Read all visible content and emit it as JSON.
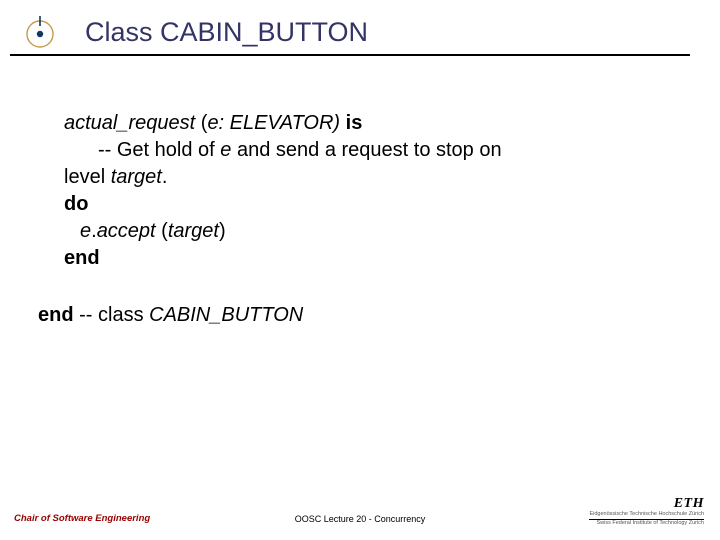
{
  "title": "Class CABIN_BUTTON",
  "code": {
    "l1_a": "actual_request ",
    "l1_b": "(",
    "l1_c": "e: ELEVATOR) ",
    "l1_d": "is",
    "l2_a": "-- Get hold of ",
    "l2_b": "e",
    "l2_c": " and send a request to stop on",
    "l3_a": "level ",
    "l3_b": "target",
    "l3_c": ".",
    "l4": "do",
    "l5_a": "e",
    "l5_b": ".",
    "l5_c": "accept ",
    "l5_d": "(",
    "l5_e": "target",
    "l5_f": ")",
    "l6": "end",
    "cls_a": "end",
    "cls_b": " -- class ",
    "cls_c": "CABIN_BUTTON"
  },
  "footer": {
    "left": "Chair of Software Engineering",
    "center": "OOSC  Lecture 20 - Concurrency",
    "eth": "ETH",
    "eth_sub_top": "Eidgenössische Technische Hochschule Zürich",
    "eth_sub_bot": "Swiss Federal Institute of Technology Zurich"
  }
}
